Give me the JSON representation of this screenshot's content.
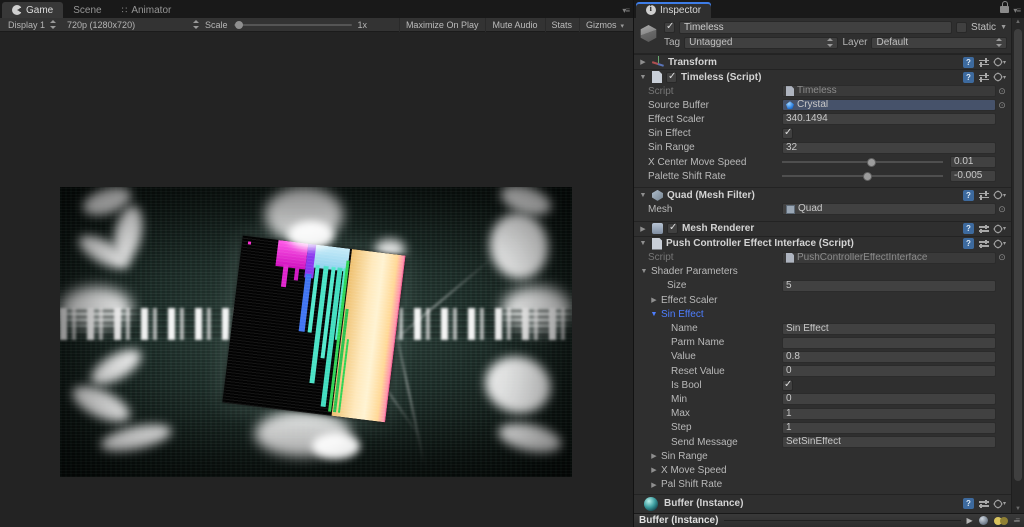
{
  "game_panel": {
    "tabs": [
      {
        "label": "Game"
      },
      {
        "label": "Scene"
      },
      {
        "label": "Animator"
      }
    ],
    "toolbar": {
      "display": "Display 1",
      "resolution": "720p (1280x720)",
      "scale_label": "Scale",
      "scale_value": "1x",
      "maximize": "Maximize On Play",
      "mute": "Mute Audio",
      "stats": "Stats",
      "gizmos": "Gizmos"
    }
  },
  "inspector": {
    "tab_label": "Inspector",
    "gameobject": {
      "name": "Timeless",
      "static_label": "Static",
      "tag_label": "Tag",
      "tag_value": "Untagged",
      "layer_label": "Layer",
      "layer_value": "Default"
    },
    "transform": {
      "title": "Transform"
    },
    "timeless": {
      "title": "Timeless (Script)",
      "script_label": "Script",
      "script_value": "Timeless",
      "source_buffer_label": "Source Buffer",
      "source_buffer_value": "Crystal",
      "effect_scaler_label": "Effect Scaler",
      "effect_scaler_value": "340.1494",
      "sin_effect_label": "Sin Effect",
      "sin_range_label": "Sin Range",
      "sin_range_value": "32",
      "x_center_label": "X Center Move Speed",
      "x_center_value": "0.01",
      "palette_label": "Palette Shift Rate",
      "palette_value": "-0.005"
    },
    "meshfilter": {
      "title": "Quad (Mesh Filter)",
      "mesh_label": "Mesh",
      "mesh_value": "Quad"
    },
    "meshrenderer": {
      "title": "Mesh Renderer"
    },
    "push": {
      "title": "Push Controller Effect Interface (Script)",
      "script_label": "Script",
      "script_value": "PushControllerEffectInterface",
      "shader_params_label": "Shader Parameters",
      "size_label": "Size",
      "size_value": "5",
      "effect_scaler_label": "Effect Scaler",
      "sin_effect_label": "Sin Effect",
      "name_label": "Name",
      "name_value": "Sin Effect",
      "parm_label": "Parm Name",
      "parm_value": "",
      "value_label": "Value",
      "value_value": "0.8",
      "reset_label": "Reset Value",
      "reset_value": "0",
      "isbool_label": "Is Bool",
      "min_label": "Min",
      "min_value": "0",
      "max_label": "Max",
      "max_value": "1",
      "step_label": "Step",
      "step_value": "1",
      "send_label": "Send Message",
      "send_value": "SetSinEffect",
      "sin_range_label": "Sin Range",
      "x_move_label": "X Move Speed",
      "pal_shift_label": "Pal Shift Rate"
    },
    "material": {
      "title": "Buffer (Instance)"
    },
    "preview": {
      "title": "Buffer (Instance)"
    }
  },
  "colors": {
    "accent_blue": "#3e7de7",
    "foldout_blue": "#4d7eff"
  }
}
